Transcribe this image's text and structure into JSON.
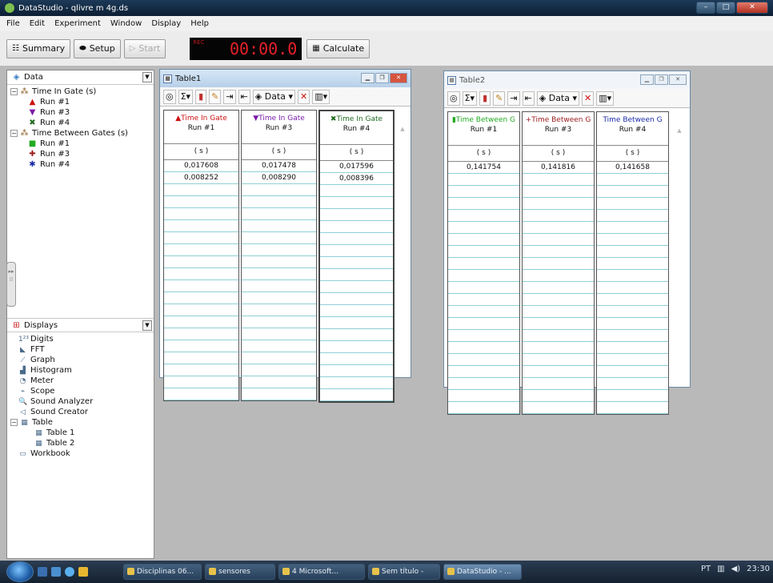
{
  "window": {
    "title": "DataStudio - qlivre m 4g.ds",
    "min": "–",
    "max": "□",
    "close": "✕"
  },
  "menu": [
    "File",
    "Edit",
    "Experiment",
    "Window",
    "Display",
    "Help"
  ],
  "toolbar": {
    "summary": "Summary",
    "setup": "Setup",
    "start": "Start",
    "timer": "00:00.0",
    "rec_label": "REC",
    "calculate": "Calculate"
  },
  "data_pane": {
    "header": "Data",
    "items": [
      {
        "label": "Time In Gate (s)",
        "level": 0,
        "marker": "",
        "color": "#333333"
      },
      {
        "label": "Run #1",
        "level": 1,
        "marker": "▲",
        "color": "#cc1111"
      },
      {
        "label": "Run #3",
        "level": 1,
        "marker": "▼",
        "color": "#7a1aa8"
      },
      {
        "label": "Run #4",
        "level": 1,
        "marker": "✖",
        "color": "#1f6a1f"
      },
      {
        "label": "Time Between Gates (s)",
        "level": 0,
        "marker": "",
        "color": "#333333"
      },
      {
        "label": "Run #1",
        "level": 1,
        "marker": "■",
        "color": "#22aa22"
      },
      {
        "label": "Run #3",
        "level": 1,
        "marker": "✚",
        "color": "#9a1a1a"
      },
      {
        "label": "Run #4",
        "level": 1,
        "marker": "✱",
        "color": "#1a2aa8"
      }
    ]
  },
  "displays_pane": {
    "header": "Displays",
    "items": [
      {
        "label": "Digits",
        "level": 1,
        "icon": "1²³"
      },
      {
        "label": "FFT",
        "level": 1,
        "icon": "◣"
      },
      {
        "label": "Graph",
        "level": 1,
        "icon": "⟋"
      },
      {
        "label": "Histogram",
        "level": 1,
        "icon": "▟"
      },
      {
        "label": "Meter",
        "level": 1,
        "icon": "◔"
      },
      {
        "label": "Scope",
        "level": 1,
        "icon": "⌁"
      },
      {
        "label": "Sound Analyzer",
        "level": 1,
        "icon": "🔍"
      },
      {
        "label": "Sound Creator",
        "level": 1,
        "icon": "◁"
      },
      {
        "label": "Table",
        "level": 0,
        "icon": "▦"
      },
      {
        "label": "Table 1",
        "level": 2,
        "icon": "▦"
      },
      {
        "label": "Table 2",
        "level": 2,
        "icon": "▦"
      },
      {
        "label": "Workbook",
        "level": 1,
        "icon": "▭"
      }
    ]
  },
  "table1": {
    "title": "Table1",
    "data_btn": "Data",
    "columns": [
      {
        "name": "Time In Gate",
        "run": "Run #1",
        "unit": "( s )",
        "marker": "▲",
        "color": "#cc1111",
        "values": [
          "0,017608",
          "0,008252"
        ]
      },
      {
        "name": "Time In Gate",
        "run": "Run #3",
        "unit": "( s )",
        "marker": "▼",
        "color": "#7a1aa8",
        "values": [
          "0,017478",
          "0,008290"
        ]
      },
      {
        "name": "Time In Gate",
        "run": "Run #4",
        "unit": "( s )",
        "marker": "✖",
        "color": "#1f6a1f",
        "values": [
          "0,017596",
          "0,008396"
        ]
      }
    ]
  },
  "table2": {
    "title": "Table2",
    "data_btn": "Data",
    "columns": [
      {
        "name": "Time Between G",
        "run": "Run #1",
        "unit": "( s )",
        "marker": "▮",
        "color": "#22aa22",
        "values": [
          "0,141754"
        ]
      },
      {
        "name": "Time Between G",
        "run": "Run #3",
        "unit": "( s )",
        "marker": "+",
        "color": "#9a1a1a",
        "values": [
          "0,141816"
        ]
      },
      {
        "name": "Time Between G",
        "run": "Run #4",
        "unit": "( s )",
        "marker": "",
        "color": "#1a2aa8",
        "values": [
          "0,141658"
        ]
      }
    ]
  },
  "taskbar": {
    "tasks": [
      "Disciplinas 06...",
      "sensores",
      "4 Microsoft...",
      "Sem título -",
      "DataStudio - ..."
    ],
    "tray": [
      "PT",
      "23:30"
    ]
  }
}
